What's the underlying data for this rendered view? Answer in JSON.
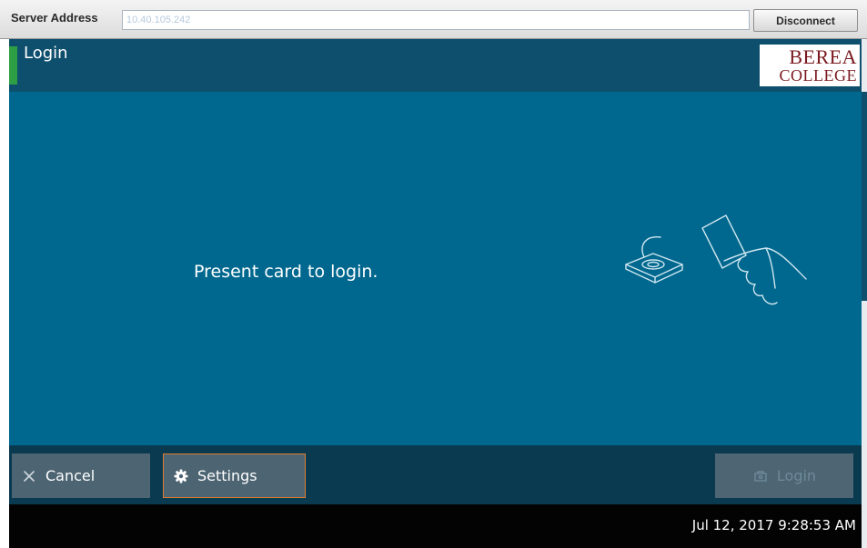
{
  "topbar": {
    "server_label": "Server Address",
    "server_value": "10.40.105.242",
    "disconnect_label": "Disconnect"
  },
  "titlebar": {
    "title": "Login",
    "logo_line1": "BEREA",
    "logo_line2": "COLLEGE"
  },
  "main": {
    "prompt": "Present card to login."
  },
  "buttons": {
    "cancel_label": "Cancel",
    "settings_label": "Settings",
    "login_label": "Login",
    "login_disabled": true
  },
  "status": {
    "datetime": "Jul 12, 2017 9:28:53 AM"
  },
  "icons": {
    "cancel": "close-icon",
    "settings": "gear-icon",
    "login": "login-icon",
    "illustration": "card-reader-icon"
  },
  "colors": {
    "main_bg": "#00688e",
    "title_bg": "#0e4f6d",
    "accent_green": "#2e9e44",
    "settings_border": "#e07c2e",
    "logo_red": "#7a1a1f"
  }
}
